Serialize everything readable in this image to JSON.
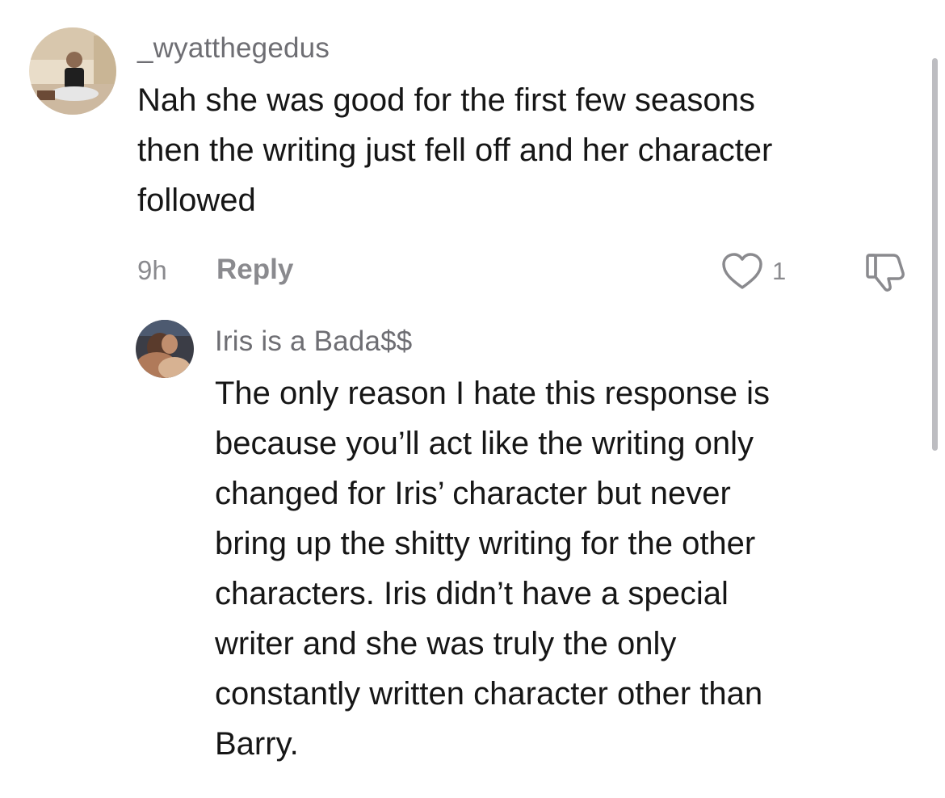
{
  "comments": [
    {
      "username": "_wyatthegedus",
      "avatar_icon": "user-avatar-photo",
      "lines": [
        "Nah she was good for the first few seasons",
        "then the writing just fell off and her character",
        "followed"
      ],
      "time": "9h",
      "reply_label": "Reply",
      "like_count": "1"
    },
    {
      "username": "Iris is a Bada$$",
      "avatar_icon": "user-avatar-photo",
      "lines": [
        "The only reason I hate this response is",
        "because you’ll act like the writing only",
        "changed for Iris’ character but never",
        "bring up the shitty writing for the other",
        "characters. Iris didn’t have a special",
        "writer and she was truly the only",
        "constantly written character other than",
        "Barry."
      ]
    }
  ],
  "colors": {
    "text": "#161616",
    "muted": "#8a8a8e",
    "username": "#6e6e73",
    "scrollbar": "#bdbdc1"
  }
}
